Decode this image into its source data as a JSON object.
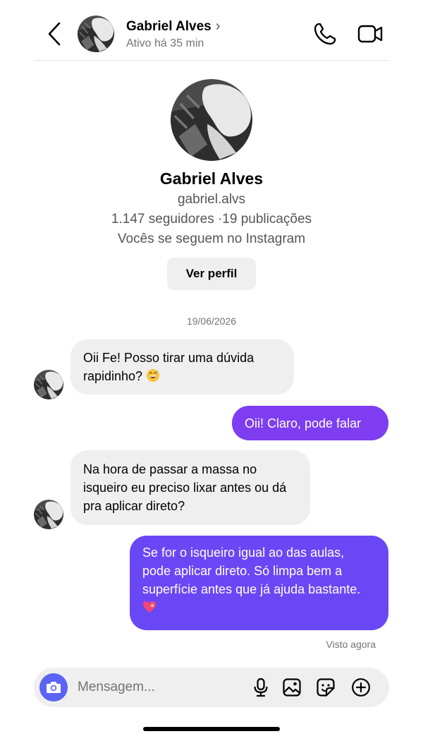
{
  "header": {
    "name": "Gabriel Alves",
    "chevron": "›",
    "status": "Ativo há 35 min",
    "icons": [
      "back-arrow-icon",
      "phone-icon",
      "video-camera-icon"
    ]
  },
  "profile": {
    "name": "Gabriel Alves",
    "username": "gabriel.alvs",
    "stats": "1.147 seguidores ·19 publicações",
    "mutual": "Vocês se seguem no Instagram",
    "view_profile_label": "Ver perfil"
  },
  "conversation": {
    "date": "19/06/2026",
    "messages": [
      {
        "from": "them",
        "text": "Oii Fe! Posso tirar uma dúvida rapidinho?",
        "emoji": "grinning-sweat-emoji"
      },
      {
        "from": "me",
        "text": "Oii! Claro, pode falar"
      },
      {
        "from": "them",
        "text": "Na hora de passar a massa no isqueiro eu preciso lixar antes ou dá pra aplicar direto?"
      },
      {
        "from": "me",
        "text": "Se for o isqueiro igual ao das aulas, pode aplicar direto. Só limpa bem a superfície antes que já ajuda bastante.",
        "emoji": "sparkling-heart-emoji"
      }
    ],
    "seen": "Visto agora"
  },
  "composer": {
    "placeholder": "Mensagem...",
    "icons": [
      "camera-icon",
      "microphone-icon",
      "gallery-icon",
      "sticker-icon",
      "plus-circle-icon"
    ]
  },
  "colors": {
    "out_bubble_1": "#7e3df0",
    "out_bubble_2": "#6a47f5",
    "in_bubble": "#efefef",
    "camera_button": "#5b64f5",
    "muted_text": "#737373"
  }
}
